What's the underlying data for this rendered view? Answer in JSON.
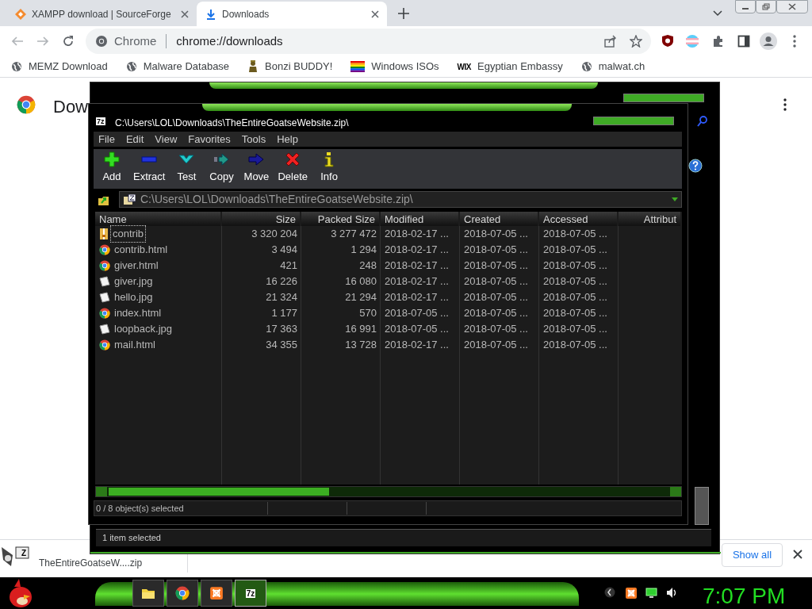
{
  "browser": {
    "tabs": [
      {
        "title": "XAMPP download | SourceForge",
        "kind": "xampp",
        "selected": false
      },
      {
        "title": "Downloads",
        "kind": "download",
        "selected": true
      }
    ],
    "omnibox": {
      "chip": "Chrome",
      "url": "chrome://downloads"
    },
    "bookmarks": [
      {
        "label": "MEMZ Download",
        "kind": "globe"
      },
      {
        "label": "Malware Database",
        "kind": "globe"
      },
      {
        "label": "Bonzi BUDDY!",
        "kind": "figure"
      },
      {
        "label": "Windows ISOs",
        "kind": "rainbow"
      },
      {
        "label": "Egyptian Embassy",
        "kind": "logo",
        "logo": "WIX"
      },
      {
        "label": "malwat.ch",
        "kind": "globe"
      }
    ]
  },
  "page": {
    "title": "Dow"
  },
  "back_window": {
    "status": "1 item selected"
  },
  "zip_window": {
    "badge": "7z",
    "title": "C:\\Users\\LOL\\Downloads\\TheEntireGoatseWebsite.zip\\",
    "menu": [
      "File",
      "Edit",
      "View",
      "Favorites",
      "Tools",
      "Help"
    ],
    "toolbar": [
      {
        "label": "Add",
        "kind": "add"
      },
      {
        "label": "Extract",
        "kind": "extract"
      },
      {
        "label": "Test",
        "kind": "test"
      },
      {
        "label": "Copy",
        "kind": "copy"
      },
      {
        "label": "Move",
        "kind": "move"
      },
      {
        "label": "Delete",
        "kind": "delete"
      },
      {
        "label": "Info",
        "kind": "info"
      }
    ],
    "path": "C:\\Users\\LOL\\Downloads\\TheEntireGoatseWebsite.zip\\",
    "columns": [
      "Name",
      "Size",
      "Packed Size",
      "Modified",
      "Created",
      "Accessed",
      "Attribut"
    ],
    "rows": [
      {
        "kind": "folder",
        "focused": true,
        "cells": [
          "contrib",
          "3 320 204",
          "3 277 472",
          "2018-02-17 ...",
          "2018-07-05 ...",
          "2018-07-05 ..."
        ]
      },
      {
        "kind": "html",
        "focused": false,
        "cells": [
          "contrib.html",
          "3 494",
          "1 294",
          "2018-02-17 ...",
          "2018-07-05 ...",
          "2018-07-05 ..."
        ]
      },
      {
        "kind": "html",
        "focused": false,
        "cells": [
          "giver.html",
          "421",
          "248",
          "2018-02-17 ...",
          "2018-07-05 ...",
          "2018-07-05 ..."
        ]
      },
      {
        "kind": "image",
        "focused": false,
        "cells": [
          "giver.jpg",
          "16 226",
          "16 080",
          "2018-02-17 ...",
          "2018-07-05 ...",
          "2018-07-05 ..."
        ]
      },
      {
        "kind": "image",
        "focused": false,
        "cells": [
          "hello.jpg",
          "21 324",
          "21 294",
          "2018-02-17 ...",
          "2018-07-05 ...",
          "2018-07-05 ..."
        ]
      },
      {
        "kind": "html",
        "focused": false,
        "cells": [
          "index.html",
          "1 177",
          "570",
          "2018-07-05 ...",
          "2018-07-05 ...",
          "2018-07-05 ..."
        ]
      },
      {
        "kind": "image",
        "focused": false,
        "cells": [
          "loopback.jpg",
          "17 363",
          "16 991",
          "2018-07-05 ...",
          "2018-07-05 ...",
          "2018-07-05 ..."
        ]
      },
      {
        "kind": "html",
        "focused": false,
        "cells": [
          "mail.html",
          "34 355",
          "13 728",
          "2018-02-17 ...",
          "2018-07-05 ...",
          "2018-07-05 ..."
        ]
      }
    ],
    "status": "0 / 8 object(s) selected"
  },
  "download_shelf": {
    "file": "TheEntireGoatseW....zip",
    "badge": "Z",
    "show_all": "Show all"
  },
  "taskbar": {
    "apps": [
      {
        "kind": "folder",
        "selected": false
      },
      {
        "kind": "chrome",
        "selected": false
      },
      {
        "kind": "xampp",
        "selected": false
      },
      {
        "kind": "archiver",
        "label": "7z",
        "selected": true
      }
    ],
    "tray": [
      {
        "kind": "back"
      },
      {
        "kind": "xampp"
      },
      {
        "kind": "monitor"
      },
      {
        "kind": "speaker"
      }
    ],
    "clock": "7:07 PM"
  }
}
